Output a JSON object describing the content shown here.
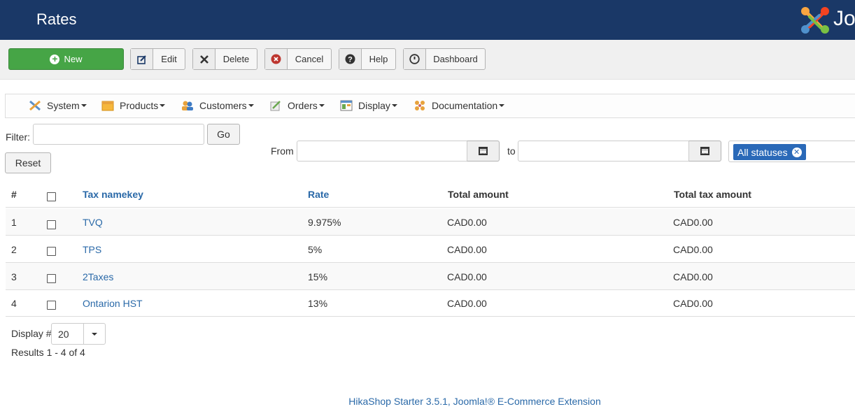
{
  "header": {
    "title": "Rates",
    "logo_text": "Jo"
  },
  "toolbar": {
    "new_label": "New",
    "edit_label": "Edit",
    "delete_label": "Delete",
    "cancel_label": "Cancel",
    "help_label": "Help",
    "dashboard_label": "Dashboard"
  },
  "menu": {
    "items": [
      {
        "label": "System",
        "icon": "tools-icon"
      },
      {
        "label": "Products",
        "icon": "products-icon"
      },
      {
        "label": "Customers",
        "icon": "customers-icon"
      },
      {
        "label": "Orders",
        "icon": "orders-icon"
      },
      {
        "label": "Display",
        "icon": "display-icon"
      },
      {
        "label": "Documentation",
        "icon": "documentation-icon"
      }
    ]
  },
  "filters": {
    "filter_label": "Filter:",
    "filter_value": "",
    "go_label": "Go",
    "reset_label": "Reset",
    "from_label": "From",
    "to_label": "to",
    "from_value": "",
    "to_value": "",
    "status_tag": "All statuses"
  },
  "table": {
    "headers": {
      "num": "#",
      "tax_namekey": "Tax namekey",
      "rate": "Rate",
      "total_amount": "Total amount",
      "total_tax_amount": "Total tax amount"
    },
    "rows": [
      {
        "num": "1",
        "namekey": "TVQ",
        "rate": "9.975%",
        "total": "CAD0.00",
        "tax_total": "CAD0.00"
      },
      {
        "num": "2",
        "namekey": "TPS",
        "rate": "5%",
        "total": "CAD0.00",
        "tax_total": "CAD0.00"
      },
      {
        "num": "3",
        "namekey": "2Taxes",
        "rate": "15%",
        "total": "CAD0.00",
        "tax_total": "CAD0.00"
      },
      {
        "num": "4",
        "namekey": "Ontarion HST",
        "rate": "13%",
        "total": "CAD0.00",
        "tax_total": "CAD0.00"
      }
    ]
  },
  "pagination": {
    "display_label": "Display #",
    "display_value": "20",
    "results_text": "Results 1 - 4 of 4"
  },
  "footer": {
    "text": "HikaShop Starter 3.5.1, Joomla!® E-Commerce Extension"
  },
  "colors": {
    "header_bg": "#1a3867",
    "new_button": "#46a546",
    "link": "#2a69a8",
    "tag": "#2a69b8"
  }
}
